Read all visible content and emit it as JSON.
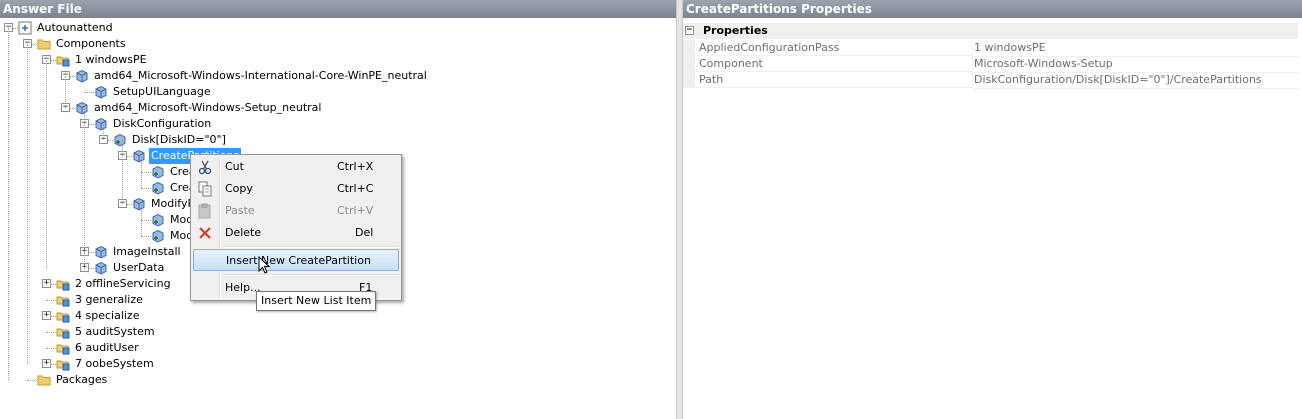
{
  "left_pane": {
    "title": "Answer File"
  },
  "right_pane": {
    "title": "CreatePartitions Properties"
  },
  "tree": [
    {
      "label": "Autounattend",
      "icon": "answer-file-icon",
      "toggle": "-"
    },
    {
      "label": "Components",
      "icon": "folder-icon",
      "toggle": "-"
    },
    {
      "label": "1 windowsPE",
      "icon": "pass-icon",
      "toggle": "-"
    },
    {
      "label": "amd64_Microsoft-Windows-International-Core-WinPE_neutral",
      "icon": "component-icon",
      "toggle": "-"
    },
    {
      "label": "SetupUILanguage",
      "icon": "setting-icon",
      "toggle": ""
    },
    {
      "label": "amd64_Microsoft-Windows-Setup_neutral",
      "icon": "component-icon",
      "toggle": "-"
    },
    {
      "label": "DiskConfiguration",
      "icon": "setting-icon",
      "toggle": "-"
    },
    {
      "label": "Disk[DiskID=\"0\"]",
      "icon": "list-item-icon",
      "toggle": "-"
    },
    {
      "label": "CreatePartitions",
      "icon": "setting-icon",
      "toggle": "-"
    },
    {
      "label": "CreatePartition[Order=\"1\"]",
      "icon": "list-item-icon",
      "toggle": ""
    },
    {
      "label": "CreatePartition[Order=\"2\"]",
      "icon": "list-item-icon",
      "toggle": ""
    },
    {
      "label": "ModifyPartitions",
      "icon": "setting-icon",
      "toggle": "-"
    },
    {
      "label": "ModifyPartition[Order=\"1\"]",
      "icon": "list-item-icon",
      "toggle": ""
    },
    {
      "label": "ModifyPartition[Order=\"2\"]",
      "icon": "list-item-icon",
      "toggle": ""
    },
    {
      "label": "ImageInstall",
      "icon": "setting-icon",
      "toggle": "+"
    },
    {
      "label": "UserData",
      "icon": "setting-icon",
      "toggle": "+"
    },
    {
      "label": "2 offlineServicing",
      "icon": "pass-icon",
      "toggle": "+"
    },
    {
      "label": "3 generalize",
      "icon": "pass-icon",
      "toggle": ""
    },
    {
      "label": "4 specialize",
      "icon": "pass-icon",
      "toggle": "+"
    },
    {
      "label": "5 auditSystem",
      "icon": "pass-icon",
      "toggle": ""
    },
    {
      "label": "6 auditUser",
      "icon": "pass-icon",
      "toggle": ""
    },
    {
      "label": "7 oobeSystem",
      "icon": "pass-icon",
      "toggle": "+"
    },
    {
      "label": "Packages",
      "icon": "folder-icon",
      "toggle": ""
    }
  ],
  "context_menu": {
    "items": [
      {
        "label": "Cut",
        "shortcut": "Ctrl+X",
        "icon": "scissors-icon",
        "enabled": true
      },
      {
        "label": "Copy",
        "shortcut": "Ctrl+C",
        "icon": "copy-icon",
        "enabled": true
      },
      {
        "label": "Paste",
        "shortcut": "Ctrl+V",
        "icon": "paste-icon",
        "enabled": false
      },
      {
        "label": "Delete",
        "shortcut": "Del",
        "icon": "delete-x-icon",
        "enabled": true
      },
      {
        "label": "Insert New CreatePartition",
        "shortcut": "",
        "icon": "",
        "enabled": true,
        "highlighted": true
      },
      {
        "label": "Help...",
        "shortcut": "F1",
        "icon": "",
        "enabled": true
      }
    ]
  },
  "tooltip": "Insert New List Item",
  "properties": {
    "category": "Properties",
    "rows": [
      {
        "name": "AppliedConfigurationPass",
        "value": "1 windowsPE"
      },
      {
        "name": "Component",
        "value": "Microsoft-Windows-Setup"
      },
      {
        "name": "Path",
        "value": "DiskConfiguration/Disk[DiskID=\"0\"]/CreatePartitions"
      }
    ]
  },
  "colors": {
    "selection": "#3399ff",
    "header": "#8a939e",
    "highlight_border": "#89b5e4"
  }
}
